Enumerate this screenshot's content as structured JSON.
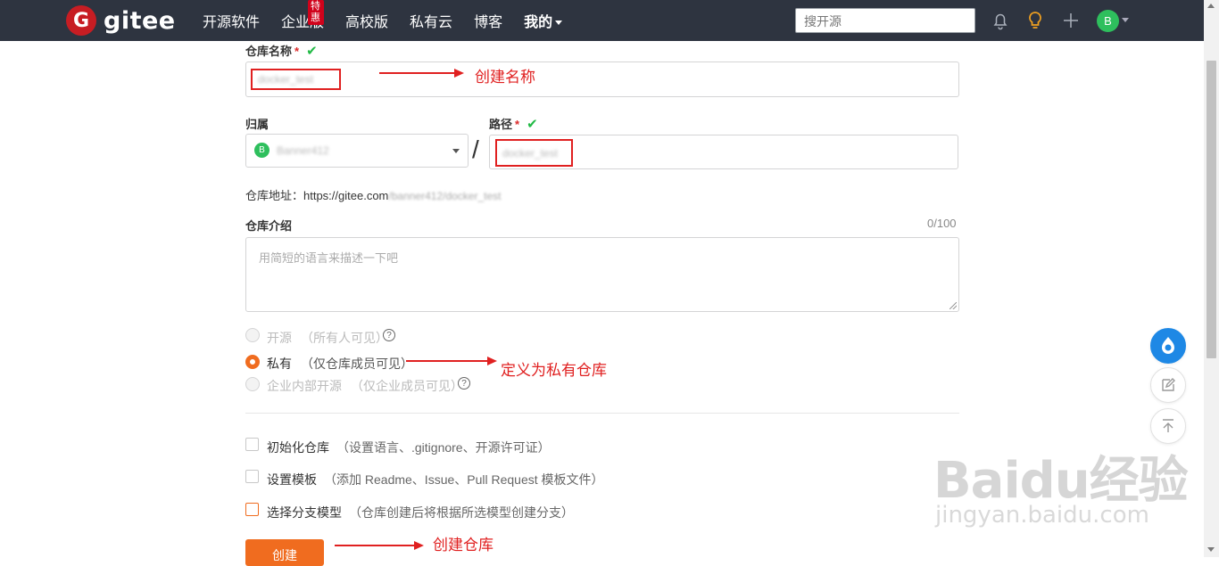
{
  "nav": {
    "logo_letter": "G",
    "logo_text": "gitee",
    "items": [
      {
        "label": "开源软件"
      },
      {
        "label": "企业版",
        "badge": "特惠"
      },
      {
        "label": "高校版"
      },
      {
        "label": "私有云"
      },
      {
        "label": "博客"
      },
      {
        "label": "我的"
      }
    ],
    "search_placeholder": "搜开源",
    "avatar_letter": "B"
  },
  "form": {
    "repo_name_label": "仓库名称",
    "required_mark": "*",
    "check_mark": "✔",
    "repo_name_value": "docker_test",
    "owner_label": "归属",
    "owner_avatar_letter": "B",
    "owner_value": "Banner412",
    "path_label": "路径",
    "path_separator": "/",
    "path_value": "docker_test",
    "address_prefix": "仓库地址：https://gitee.com",
    "address_rest": "/banner412/docker_test",
    "intro_label": "仓库介绍",
    "intro_counter": "0/100",
    "intro_placeholder": "用简短的语言来描述一下吧",
    "visibility": [
      {
        "label": "开源",
        "hint": "（所有人可见）",
        "selected": false,
        "disabled": true,
        "help": true
      },
      {
        "label": "私有",
        "hint": "（仅仓库成员可见）",
        "selected": true,
        "disabled": false,
        "help": false
      },
      {
        "label": "企业内部开源",
        "hint": "（仅企业成员可见）",
        "selected": false,
        "disabled": true,
        "help": true
      }
    ],
    "options": [
      {
        "label": "初始化仓库",
        "hint": "（设置语言、.gitignore、开源许可证）"
      },
      {
        "label": "设置模板",
        "hint": "（添加 Readme、Issue、Pull Request 模板文件）"
      },
      {
        "label": "选择分支模型",
        "hint": "（仓库创建后将根据所选模型创建分支）"
      }
    ],
    "create_button": "创建"
  },
  "annotations": {
    "name": "创建名称",
    "private": "定义为私有仓库",
    "create": "创建仓库"
  },
  "watermark": {
    "brand": "Baidu经验",
    "url": "jingyan.baidu.com"
  },
  "colors": {
    "nav_bg": "#2e3440",
    "brand_red": "#c71d23",
    "accent_orange": "#f06c1f",
    "annotation_red": "#e02020",
    "success_green": "#21ba45"
  },
  "icons": [
    "bell-icon",
    "lightbulb-icon",
    "plus-icon",
    "chat-icon",
    "edit-icon",
    "back-to-top-icon",
    "help-icon"
  ]
}
